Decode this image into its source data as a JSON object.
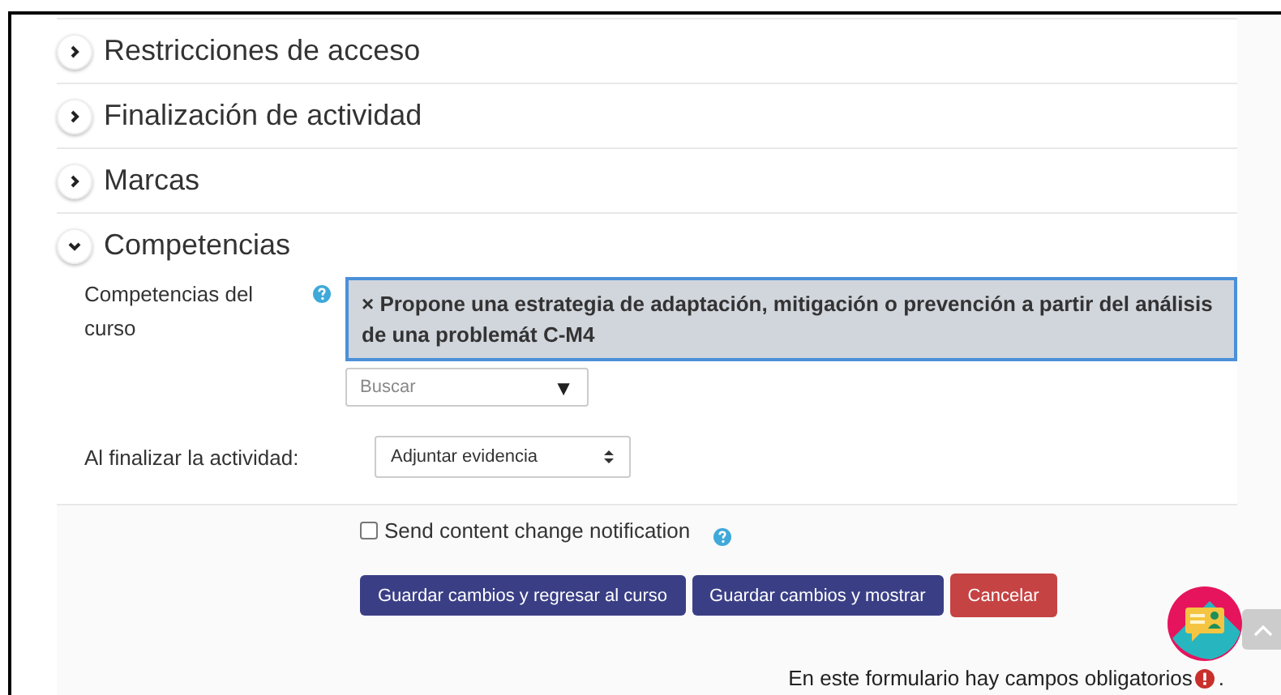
{
  "sections": [
    {
      "title": "Restricciones de acceso",
      "expanded": false
    },
    {
      "title": "Finalización de actividad",
      "expanded": false
    },
    {
      "title": "Marcas",
      "expanded": false
    },
    {
      "title": "Competencias",
      "expanded": true
    }
  ],
  "competencies": {
    "label": "Competencias del curso",
    "selected_item": "× Propone una estrategia de adaptación, mitigación o prevención a partir del análisis de una problemát C-M4",
    "search_placeholder": "Buscar",
    "search_caret": "▼"
  },
  "on_complete": {
    "label": "Al finalizar la actividad:",
    "value": "Adjuntar evidencia"
  },
  "notification": {
    "label": "Send content change notification",
    "checked": false
  },
  "buttons": [
    {
      "label": "Guardar cambios y regresar al curso",
      "kind": "primary"
    },
    {
      "label": "Guardar cambios y mostrar",
      "kind": "primary"
    },
    {
      "label": "Cancelar",
      "kind": "danger"
    }
  ],
  "required_note": "En este formulario hay campos obligatorios",
  "required_tail": "."
}
